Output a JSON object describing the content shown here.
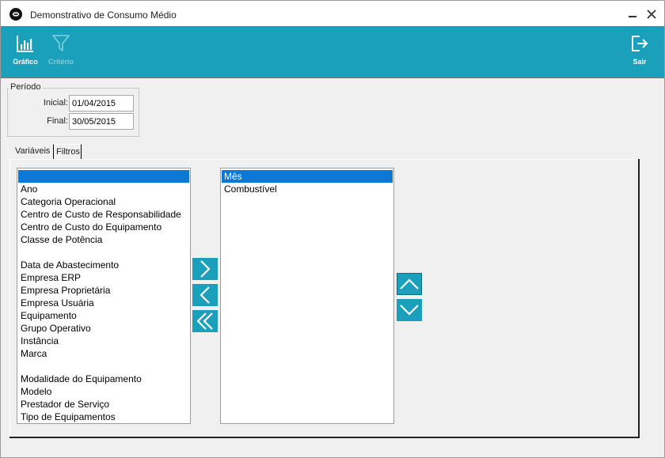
{
  "window": {
    "title": "Demonstrativo de Consumo Médio"
  },
  "toolbar": {
    "grafico_label": "Gráfico",
    "criterio_label": "Critério",
    "sair_label": "Sair"
  },
  "periodo": {
    "legend": "Período",
    "inicial_label": "Inicial:",
    "inicial_value": "01/04/2015",
    "final_label": "Final:",
    "final_value": "30/05/2015"
  },
  "tabs": {
    "variaveis": "Variáveis",
    "filtros": "Filtros"
  },
  "available": [
    "",
    "Ano",
    "Categoria Operacional",
    "Centro de Custo de Responsabilidade",
    "Centro de Custo do Equipamento",
    "Classe de Potência",
    "",
    "Data de Abastecimento",
    "Empresa ERP",
    "Empresa Proprietária",
    "Empresa Usuária",
    "Equipamento",
    "Grupo Operativo",
    "Instância",
    "Marca",
    "",
    "Modalidade do Equipamento",
    "Modelo",
    "Prestador de Serviço",
    "Tipo de Equipamentos"
  ],
  "selected": [
    "Mês",
    "Combustível"
  ],
  "colors": {
    "accent": "#1aa0ba",
    "selection": "#0a78d7"
  }
}
